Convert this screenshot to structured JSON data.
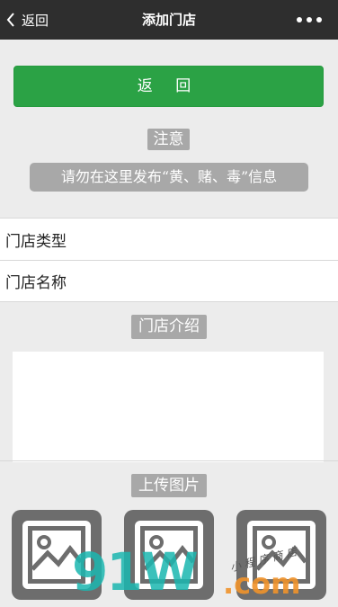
{
  "navbar": {
    "back_label": "返回",
    "title": "添加门店"
  },
  "back_button_label": "返 回",
  "notice": {
    "title": "注意",
    "text": "请勿在这里发布“黄、赌、毒”信息"
  },
  "form": {
    "store_type_label": "门店类型",
    "store_name_label": "门店名称",
    "intro_title": "门店介绍",
    "upload_title": "上传图片"
  },
  "watermark": {
    "brand": "91W",
    "suffix": ".com",
    "tagline": "小程序商店"
  }
}
